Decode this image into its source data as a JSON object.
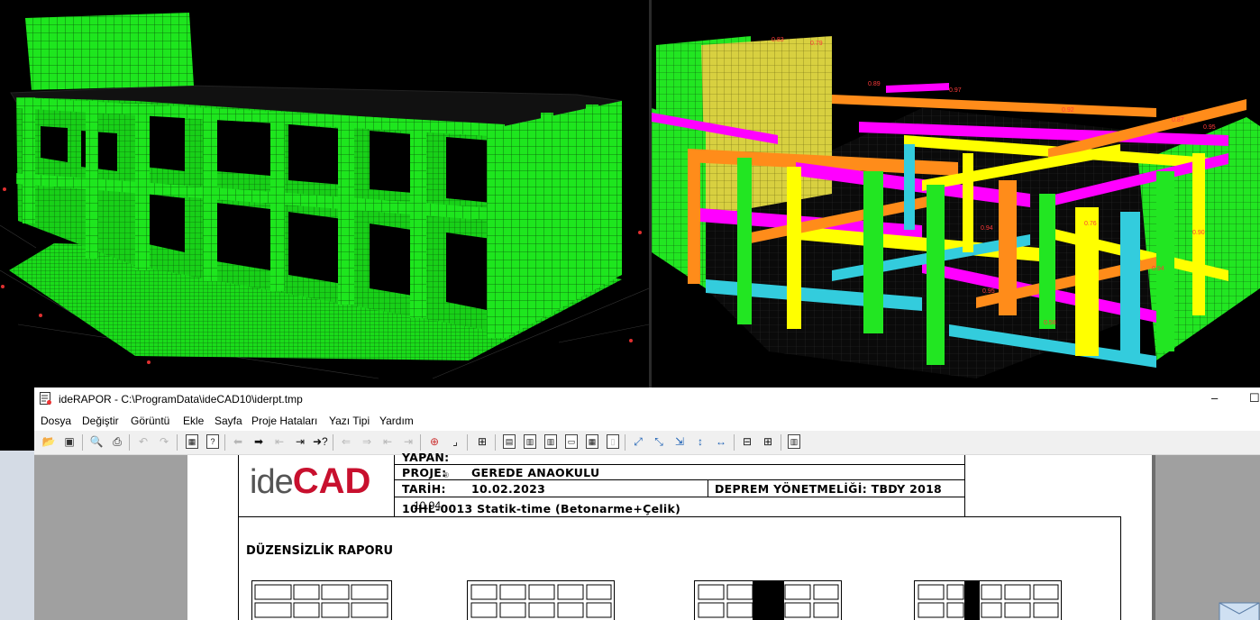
{
  "window": {
    "title": "ideRAPOR - C:\\ProgramData\\ideCAD10\\iderpt.tmp",
    "minimize": "–",
    "maximize": "☐"
  },
  "menu": [
    "Dosya",
    "Değiştir",
    "Görüntü",
    "Ekle",
    "Sayfa",
    "Proje Hataları",
    "Yazı Tipi",
    "Yardım"
  ],
  "report": {
    "logo_ide": "ide",
    "logo_cad": "CAD",
    "logo_reg": "®",
    "logo_version": "10.94",
    "yapan_label": "YAPAN:",
    "proje_label": "PROJE:",
    "proje_value": "GEREDE ANAOKULU",
    "tarih_label": "TARİH:",
    "tarih_value": "10.02.2023",
    "deprem": "DEPREM YÖNETMELİĞİ: TBDY 2018",
    "module": "10HL-0013 Statik-time (Betonarme+Çelik)",
    "section_title": "DÜZENSİZLİK RAPORU"
  },
  "viewport_right_labels": [
    "0.83",
    "0.79",
    "0.89",
    "0.92",
    "0.87",
    "0.95",
    "0.97",
    "0.94",
    "0.95",
    "0.58",
    "0.76",
    "0.94",
    "0.90"
  ],
  "colors": {
    "mesh_green": "#1ee61e",
    "beam_magenta": "#ff00ff",
    "beam_orange": "#ff8c1a",
    "beam_yellow": "#ffff00",
    "beam_cyan": "#33ccdd",
    "logo_red": "#c8102e"
  }
}
